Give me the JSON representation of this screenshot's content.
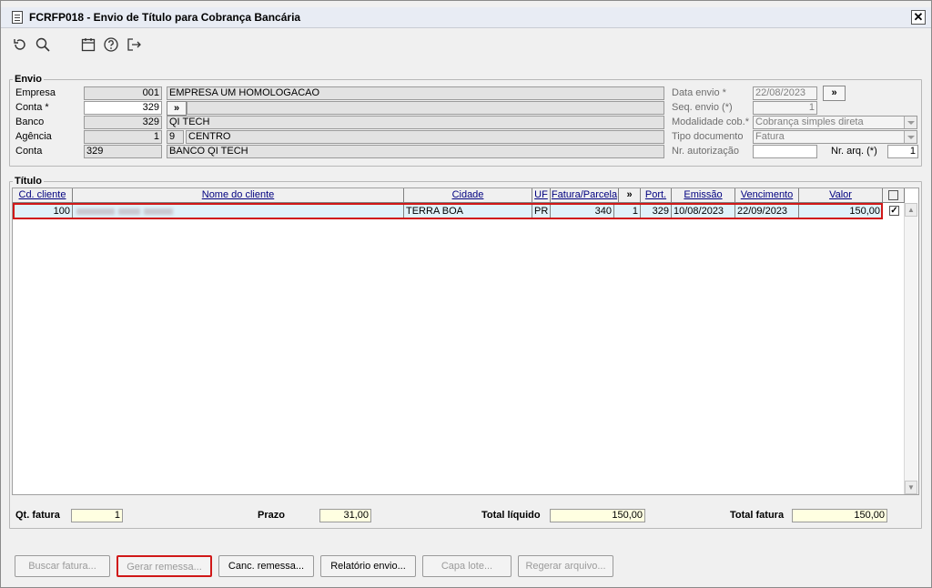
{
  "window": {
    "title": "FCRFP018 - Envio de Título para Cobrança Bancária",
    "close": "✕"
  },
  "toolbar": {
    "icons": [
      "refresh-icon",
      "search-icon",
      "calendar-icon",
      "help-icon",
      "exit-icon"
    ]
  },
  "envio": {
    "legend": "Envio",
    "empresa": {
      "label": "Empresa",
      "code": "001",
      "name": "EMPRESA UM HOMOLOGACAO"
    },
    "conta": {
      "label": "Conta *",
      "value": "329",
      "btn": "»"
    },
    "banco": {
      "label": "Banco",
      "code": "329",
      "name": "QI TECH"
    },
    "agencia": {
      "label": "Agência",
      "code": "1",
      "digit": "9",
      "name": "CENTRO"
    },
    "conta2": {
      "label": "Conta",
      "code": "329",
      "name": "BANCO QI TECH"
    },
    "data_envio": {
      "label": "Data envio *",
      "value": "22/08/2023",
      "btn": "»"
    },
    "seq_envio": {
      "label": "Seq. envio (*)",
      "value": "1"
    },
    "modalidade": {
      "label": "Modalidade cob.*",
      "value": "Cobrança simples direta"
    },
    "tipo_doc": {
      "label": "Tipo documento",
      "value": "Fatura"
    },
    "nr_aut": {
      "label": "Nr. autorização",
      "value": ""
    },
    "nr_arq": {
      "label": "Nr. arq. (*)",
      "value": "1"
    }
  },
  "titulo": {
    "legend": "Título",
    "columns": [
      "Cd. cliente",
      "Nome do cliente",
      "Cidade",
      "UF",
      "Fatura/Parcela",
      "»",
      "Port.",
      "Emissão",
      "Vencimento",
      "Valor"
    ],
    "rows": [
      {
        "cd": "100",
        "nome": "",
        "cidade": "TERRA BOA",
        "uf": "PR",
        "fatura": "340",
        "parcela": "1",
        "port": "329",
        "emissao": "10/08/2023",
        "vencimento": "22/09/2023",
        "valor": "150,00",
        "checked": "✓"
      }
    ]
  },
  "totals": {
    "qt_fatura": {
      "label": "Qt. fatura",
      "value": "1"
    },
    "prazo": {
      "label": "Prazo",
      "value": "31,00"
    },
    "total_liquido": {
      "label": "Total líquido",
      "value": "150,00"
    },
    "total_fatura": {
      "label": "Total fatura",
      "value": "150,00"
    }
  },
  "buttons": {
    "buscar": "Buscar fatura...",
    "gerar": "Gerar remessa...",
    "canc": "Canc. remessa...",
    "relatorio": "Relatório envio...",
    "capa": "Capa lote...",
    "regerar": "Regerar arquivo..."
  }
}
